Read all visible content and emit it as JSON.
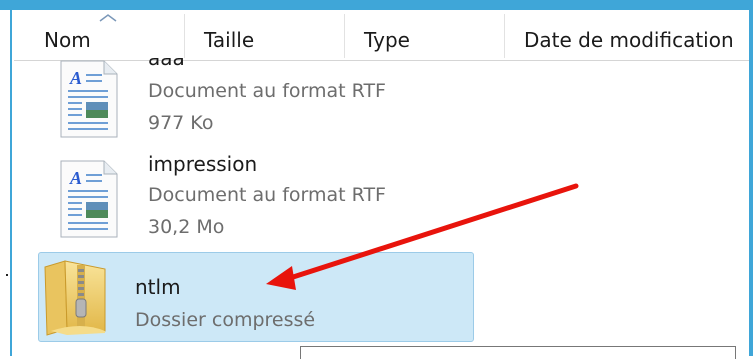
{
  "columns": {
    "name": "Nom",
    "size": "Taille",
    "type": "Type",
    "modified": "Date de modification"
  },
  "files": [
    {
      "name": "aaa",
      "type": "Document au format RTF",
      "size": "977 Ko",
      "icon": "rtf-document-icon"
    },
    {
      "name": "impression",
      "type": "Document au format RTF",
      "size": "30,2 Mo",
      "icon": "rtf-document-icon"
    },
    {
      "name": "ntlm",
      "type": "Dossier compressé",
      "size": "",
      "icon": "zip-folder-icon",
      "selected": true
    }
  ],
  "annotation": {
    "color": "#e8140c",
    "icon": "annotation-arrow"
  },
  "colors": {
    "accent": "#3fa6d8",
    "selection": "#cde8f7"
  }
}
